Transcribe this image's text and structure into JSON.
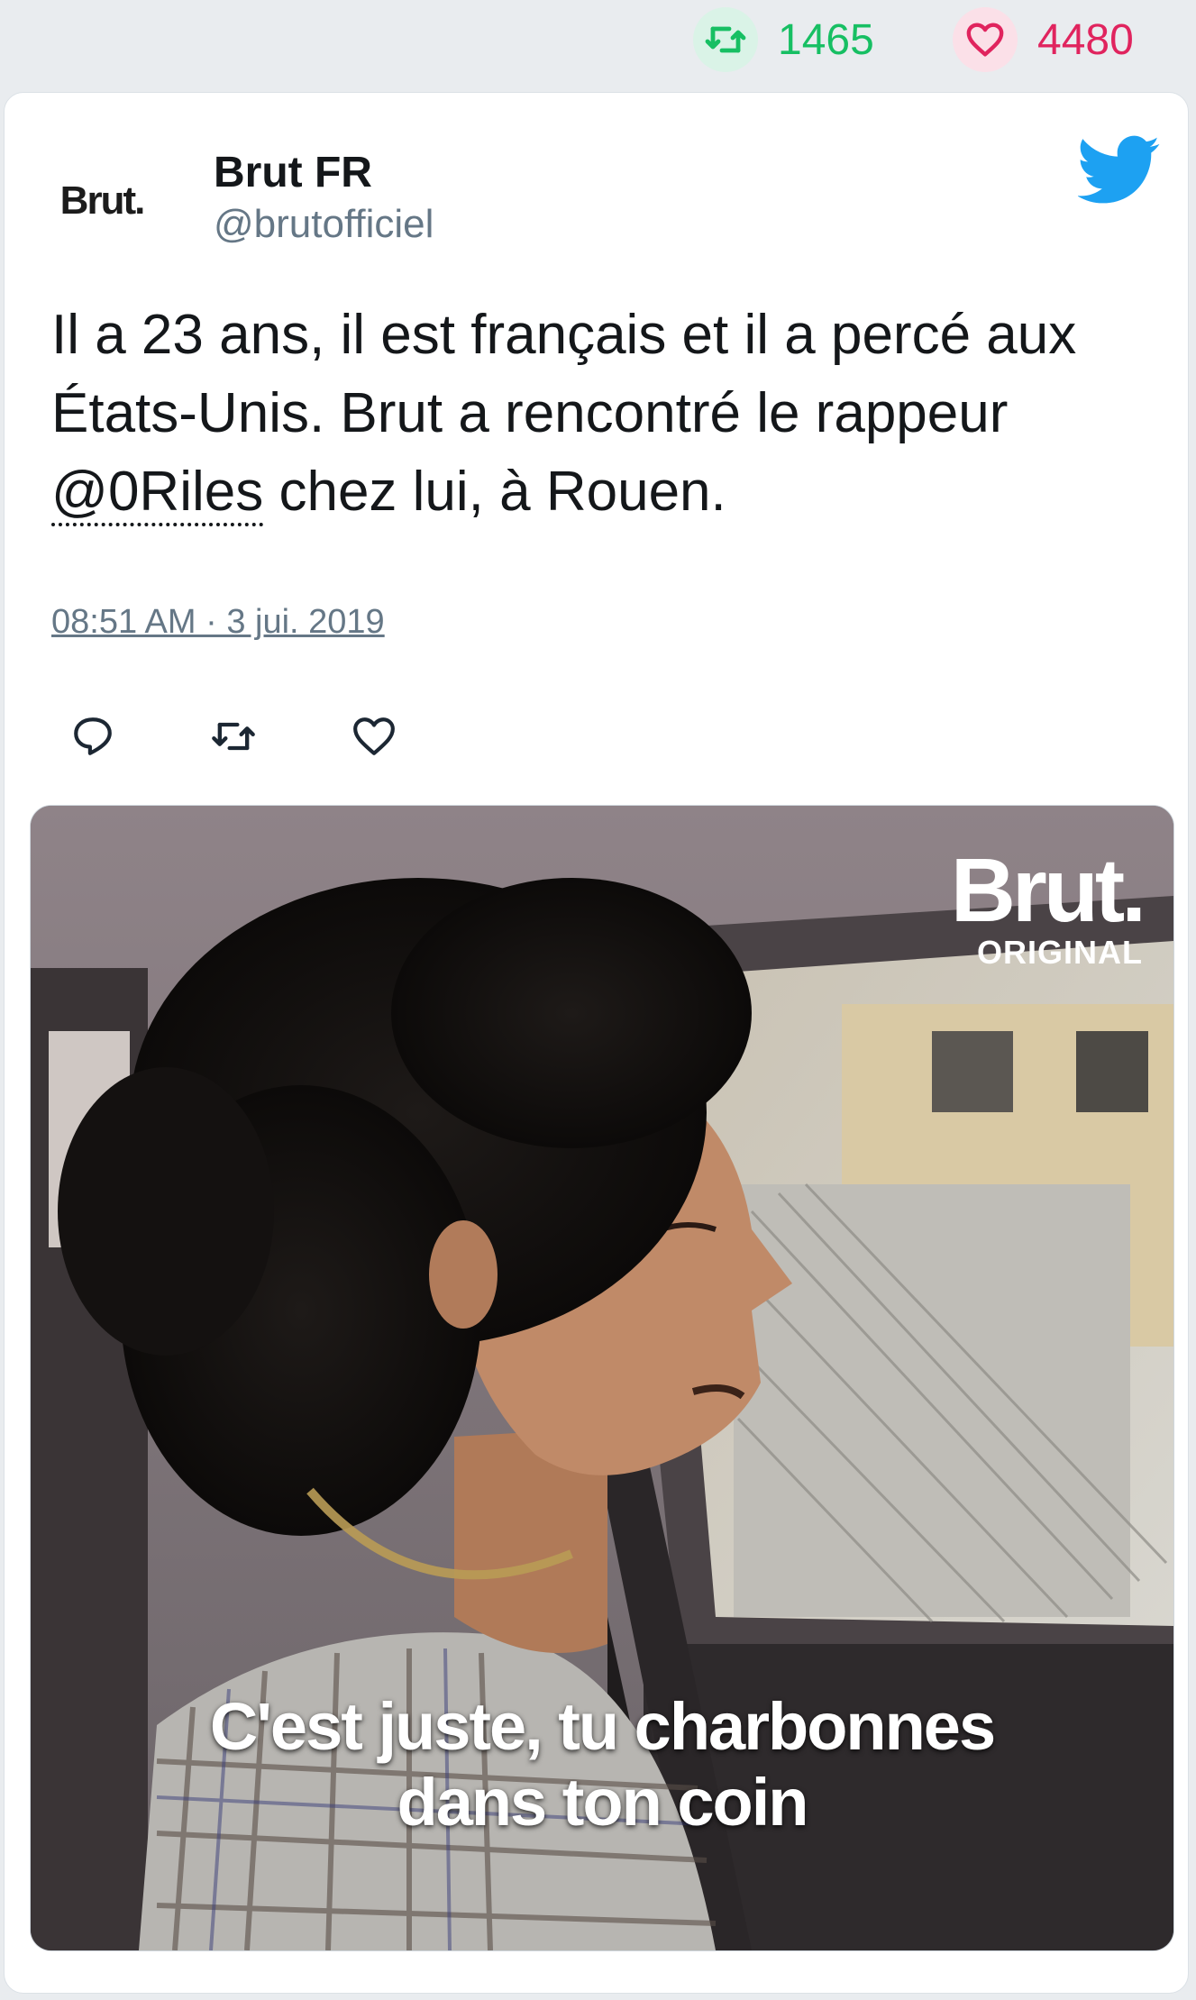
{
  "stats": {
    "retweets": "1465",
    "likes": "4480",
    "retweet_icon": "retweet-icon",
    "like_icon": "heart-icon",
    "retweet_color": "#17bf63",
    "like_color": "#e0245e"
  },
  "tweet": {
    "avatar_text": "Brut.",
    "author_name": "Brut FR",
    "author_handle": "@brutofficiel",
    "text_part1": "Il a 23 ans, il est français et il a percé aux États-Unis. Brut a rencontré le rappeur ",
    "mention": "@0Riles",
    "text_part2": " chez lui, à Rouen.",
    "timestamp": "08:51 AM · 3 jui. 2019",
    "platform_icon": "twitter-bird-icon",
    "accent_color": "#1da1f2"
  },
  "media": {
    "logo_brand": "Brut.",
    "logo_sub": "ORIGINAL",
    "caption_line1": "C'est juste, tu charbonnes",
    "caption_line2": "dans ton coin"
  }
}
